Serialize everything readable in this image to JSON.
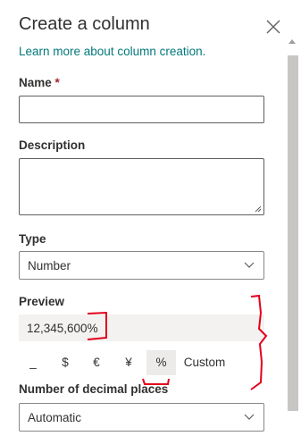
{
  "panel": {
    "title": "Create a column",
    "learn_more": "Learn more about column creation."
  },
  "fields": {
    "name_label": "Name",
    "required_mark": "*",
    "name_value": "",
    "description_label": "Description",
    "description_value": "",
    "type_label": "Type",
    "type_value": "Number",
    "preview_label": "Preview",
    "preview_value": "12,345,600%",
    "decimal_label": "Number of decimal places",
    "decimal_value": "Automatic"
  },
  "format_buttons": [
    {
      "label": "_",
      "selected": false
    },
    {
      "label": "$",
      "selected": false
    },
    {
      "label": "€",
      "selected": false
    },
    {
      "label": "¥",
      "selected": false
    },
    {
      "label": "%",
      "selected": true
    },
    {
      "label": "Custom",
      "selected": false
    }
  ],
  "icons": {
    "close": "close-icon",
    "chevron": "chevron-down-icon"
  },
  "colors": {
    "link": "#03787c",
    "required": "#a4262c",
    "annotation": "#e3001b"
  }
}
